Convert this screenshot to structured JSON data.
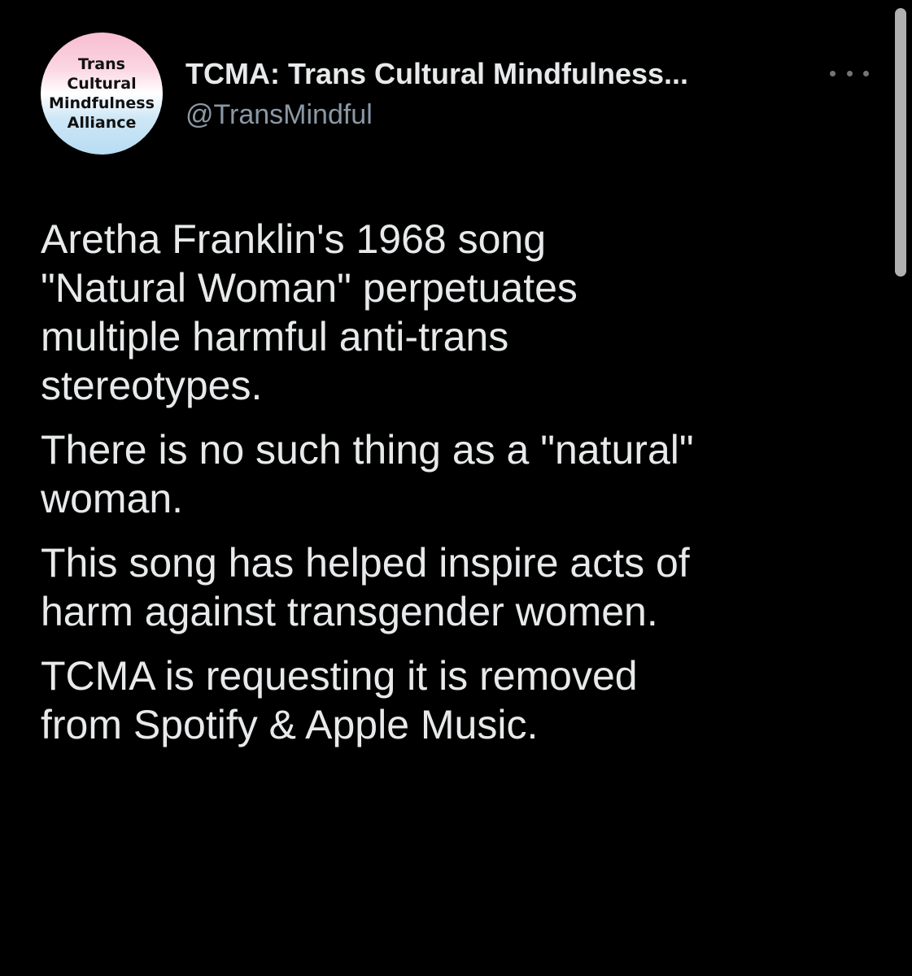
{
  "account": {
    "display_name": "TCMA: Trans Cultural Mindfulness...",
    "handle": "@TransMindful",
    "avatar_lines": [
      "Trans",
      "Cultural",
      "Mindfulness",
      "Alliance"
    ],
    "avatar_colors": [
      "#f7bdd0",
      "#ffffff",
      "#b7dcf2"
    ]
  },
  "more_icon": "more-horizontal-icon",
  "tweet": {
    "paragraphs": [
      [
        "Aretha Franklin's 1968 song",
        "\"Natural Woman\" perpetuates",
        "multiple harmful anti-trans",
        "stereotypes."
      ],
      [
        "There is no such thing as a \"natural\"",
        "woman."
      ],
      [
        "This song has helped inspire acts of",
        "harm against transgender women."
      ],
      [
        "TCMA is requesting it is removed",
        "from Spotify & Apple Music."
      ]
    ]
  },
  "colors": {
    "background": "#000000",
    "text_primary": "#e7e9ea",
    "text_secondary": "#8b98a5"
  }
}
